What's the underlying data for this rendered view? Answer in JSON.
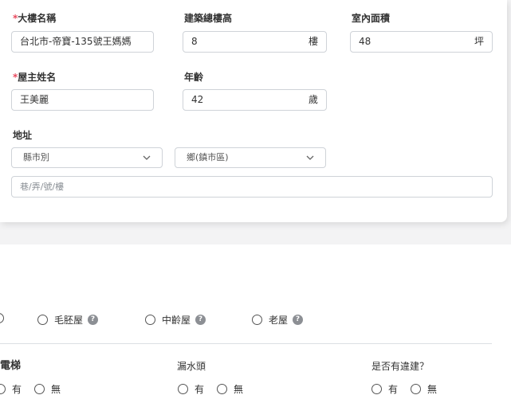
{
  "building_info": {
    "building_name": {
      "label": "大樓名稱",
      "value": "台北市-帝寶-135號王媽媽"
    },
    "total_floors": {
      "label": "建築總樓高",
      "value": "8",
      "unit": "樓"
    },
    "indoor_area": {
      "label": "室內面積",
      "value": "48",
      "unit": "坪"
    },
    "owner_name": {
      "label": "屋主姓名",
      "value": "王美麗"
    },
    "age": {
      "label": "年齡",
      "value": "42",
      "unit": "歲"
    },
    "address": {
      "label": "地址",
      "county_select": "縣市別",
      "district_select": "鄉(鎮市區)",
      "street_placeholder": "巷/弄/號/樓"
    },
    "required_mark": "*"
  },
  "house_type": {
    "options": [
      {
        "label": "毛胚屋",
        "help": "?"
      },
      {
        "label": "中齡屋",
        "help": "?"
      },
      {
        "label": "老屋",
        "help": "?"
      }
    ]
  },
  "features": {
    "elevator": {
      "label": "電梯",
      "yes": "有",
      "no": "無"
    },
    "leaking": {
      "label": "漏水頭",
      "yes": "有",
      "no": "無"
    },
    "illegal_build": {
      "label": "是否有違建？",
      "yes": "有",
      "no": "無"
    }
  },
  "colors": {
    "required": "#e84a5f",
    "border": "#cfd3d8",
    "help_icon": "#8c8f94"
  }
}
